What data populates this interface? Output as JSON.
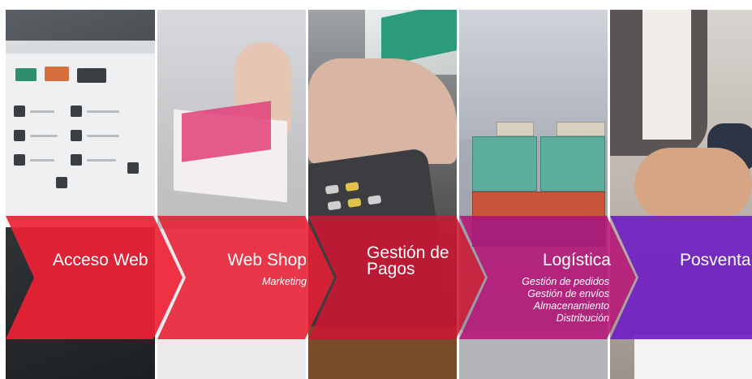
{
  "steps": [
    {
      "title": "Acceso Web",
      "items": []
    },
    {
      "title": "Web Shop",
      "items": [
        "Marketing"
      ]
    },
    {
      "title_lines": [
        "Gestión de",
        "Pagos"
      ],
      "items": []
    },
    {
      "title": "Logística",
      "items": [
        "Gestión de pedidos",
        "Gestión de envíos",
        "Almacenamiento",
        "Distribución"
      ]
    },
    {
      "title": "Posventa",
      "items": []
    }
  ],
  "colors": {
    "ribbon_1": "#ef2135",
    "ribbon_2": "#e61e32",
    "ribbon_3": "#cc1632",
    "ribbon_4": "#b61476",
    "ribbon_5": "#6e1cc4"
  }
}
